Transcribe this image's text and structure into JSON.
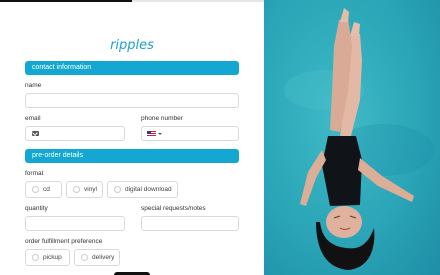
{
  "form": {
    "progress": 0.5,
    "title": "ripples",
    "sections": {
      "contact": "contact information",
      "preorder": "pre-order details"
    },
    "fields": {
      "name": {
        "label": "name",
        "value": ""
      },
      "email": {
        "label": "email",
        "value": ""
      },
      "phone": {
        "label": "phone number",
        "value": ""
      },
      "quantity": {
        "label": "quantity",
        "value": ""
      },
      "requests": {
        "label": "special requests/notes",
        "value": ""
      }
    },
    "format": {
      "label": "format",
      "options": [
        "cd",
        "vinyl",
        "digital download"
      ]
    },
    "fulfillment": {
      "label": "order fulfillment preference",
      "options": [
        "pickup",
        "delivery"
      ]
    }
  },
  "colors": {
    "accent": "#13a7d1",
    "title": "#1aa3c9",
    "pool": "#2aa5b7"
  },
  "icons": {
    "email": "mail-icon",
    "phone_country": "us-flag-icon"
  }
}
